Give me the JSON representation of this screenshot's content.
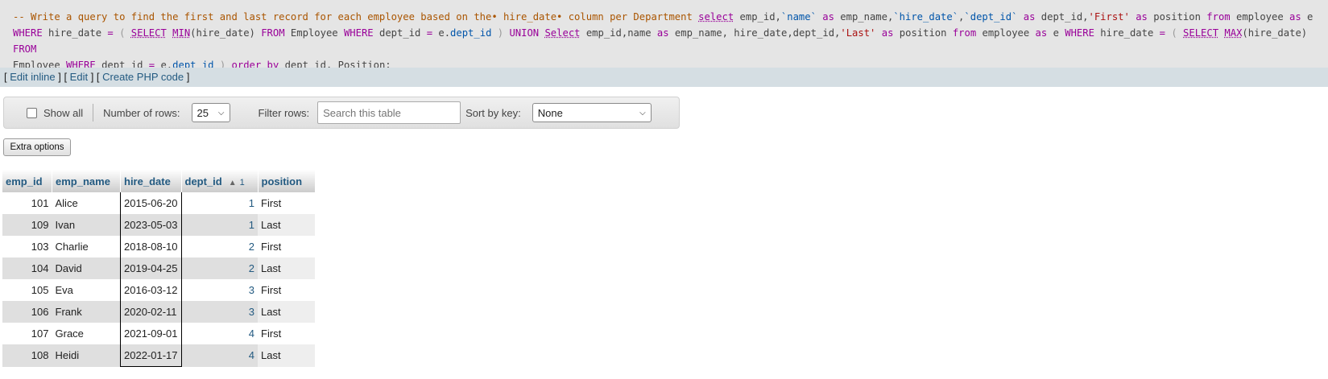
{
  "sql": {
    "line1": [
      {
        "t": "-- Write a query to find the first and last record for each employee based on the• hire_date• column per Department ",
        "c": "cm"
      },
      {
        "t": "select",
        "c": "ln"
      },
      {
        "t": " emp_id,",
        "c": ""
      },
      {
        "t": "`name`",
        "c": "bt"
      },
      {
        "t": " as ",
        "c": "kw"
      },
      {
        "t": "emp_name,",
        "c": ""
      },
      {
        "t": "`hire_date`",
        "c": "bt"
      },
      {
        "t": ",",
        "c": ""
      },
      {
        "t": "`dept_id`",
        "c": "bt"
      },
      {
        "t": " as ",
        "c": "kw"
      },
      {
        "t": "dept_id,",
        "c": ""
      },
      {
        "t": "'First'",
        "c": "st"
      },
      {
        "t": " as ",
        "c": "kw"
      },
      {
        "t": "position ",
        "c": ""
      },
      {
        "t": "from",
        "c": "kw"
      },
      {
        "t": " employee ",
        "c": ""
      },
      {
        "t": "as",
        "c": "kw"
      },
      {
        "t": " e",
        "c": ""
      }
    ],
    "line2": [
      {
        "t": "WHERE",
        "c": "kw"
      },
      {
        "t": " hire_date ",
        "c": ""
      },
      {
        "t": "=",
        "c": "op"
      },
      {
        "t": " ( ",
        "c": "br"
      },
      {
        "t": "SELECT",
        "c": "ln"
      },
      {
        "t": " ",
        "c": ""
      },
      {
        "t": "MIN",
        "c": "fn"
      },
      {
        "t": "(hire_date) ",
        "c": ""
      },
      {
        "t": "FROM",
        "c": "kw"
      },
      {
        "t": " Employee ",
        "c": ""
      },
      {
        "t": "WHERE",
        "c": "kw"
      },
      {
        "t": " dept_id ",
        "c": ""
      },
      {
        "t": "=",
        "c": "op"
      },
      {
        "t": " e.",
        "c": ""
      },
      {
        "t": "dept_id",
        "c": "qf"
      },
      {
        "t": " ) ",
        "c": "br"
      },
      {
        "t": "UNION",
        "c": "kw"
      },
      {
        "t": " ",
        "c": ""
      },
      {
        "t": "Select",
        "c": "ln"
      },
      {
        "t": " emp_id,name ",
        "c": ""
      },
      {
        "t": "as",
        "c": "kw"
      },
      {
        "t": " emp_name, hire_date,dept_id,",
        "c": ""
      },
      {
        "t": "'Last'",
        "c": "st"
      },
      {
        "t": " as ",
        "c": "kw"
      },
      {
        "t": "position ",
        "c": ""
      },
      {
        "t": "from",
        "c": "kw"
      },
      {
        "t": " employee ",
        "c": ""
      },
      {
        "t": "as",
        "c": "kw"
      },
      {
        "t": " e ",
        "c": ""
      },
      {
        "t": "WHERE",
        "c": "kw"
      },
      {
        "t": " hire_date ",
        "c": ""
      },
      {
        "t": "=",
        "c": "op"
      },
      {
        "t": " ( ",
        "c": "br"
      },
      {
        "t": "SELECT",
        "c": "ln"
      },
      {
        "t": " ",
        "c": ""
      },
      {
        "t": "MAX",
        "c": "fn"
      },
      {
        "t": "(hire_date) ",
        "c": ""
      },
      {
        "t": "FROM",
        "c": "kw"
      }
    ],
    "line3": [
      {
        "t": "Employee ",
        "c": ""
      },
      {
        "t": "WHERE",
        "c": "kw"
      },
      {
        "t": " dept_id ",
        "c": ""
      },
      {
        "t": "=",
        "c": "op"
      },
      {
        "t": " e.",
        "c": ""
      },
      {
        "t": "dept_id",
        "c": "qf"
      },
      {
        "t": " ) ",
        "c": "br"
      },
      {
        "t": "order by",
        "c": "kw"
      },
      {
        "t": " dept_id, Position;",
        "c": ""
      }
    ]
  },
  "edit_links": {
    "open1": "[ ",
    "edit_inline": "Edit inline",
    "sep1": " ] [ ",
    "edit": "Edit",
    "sep2": " ] [ ",
    "create_php": "Create PHP code",
    "close": " ]"
  },
  "options": {
    "show_all_label": "Show all",
    "show_all_checked": false,
    "num_rows_label": "Number of rows:",
    "num_rows_value": "25",
    "filter_label": "Filter rows:",
    "filter_placeholder": "Search this table",
    "sort_label": "Sort by key:",
    "sort_value": "None"
  },
  "extra_options_label": "Extra options",
  "table": {
    "headers": {
      "emp_id": "emp_id",
      "emp_name": "emp_name",
      "hire_date": "hire_date",
      "dept_id": "dept_id",
      "dept_sort_symbol": "▲",
      "dept_sort_order": "1",
      "position": "position"
    },
    "rows": [
      {
        "emp_id": "101",
        "emp_name": "Alice",
        "hire_date": "2015-06-20",
        "dept_id": "1",
        "position": "First"
      },
      {
        "emp_id": "109",
        "emp_name": "Ivan",
        "hire_date": "2023-05-03",
        "dept_id": "1",
        "position": "Last"
      },
      {
        "emp_id": "103",
        "emp_name": "Charlie",
        "hire_date": "2018-08-10",
        "dept_id": "2",
        "position": "First"
      },
      {
        "emp_id": "104",
        "emp_name": "David",
        "hire_date": "2019-04-25",
        "dept_id": "2",
        "position": "Last"
      },
      {
        "emp_id": "105",
        "emp_name": "Eva",
        "hire_date": "2016-03-12",
        "dept_id": "3",
        "position": "First"
      },
      {
        "emp_id": "106",
        "emp_name": "Frank",
        "hire_date": "2020-02-11",
        "dept_id": "3",
        "position": "Last"
      },
      {
        "emp_id": "107",
        "emp_name": "Grace",
        "hire_date": "2021-09-01",
        "dept_id": "4",
        "position": "First"
      },
      {
        "emp_id": "108",
        "emp_name": "Heidi",
        "hire_date": "2022-01-17",
        "dept_id": "4",
        "position": "Last"
      }
    ]
  }
}
